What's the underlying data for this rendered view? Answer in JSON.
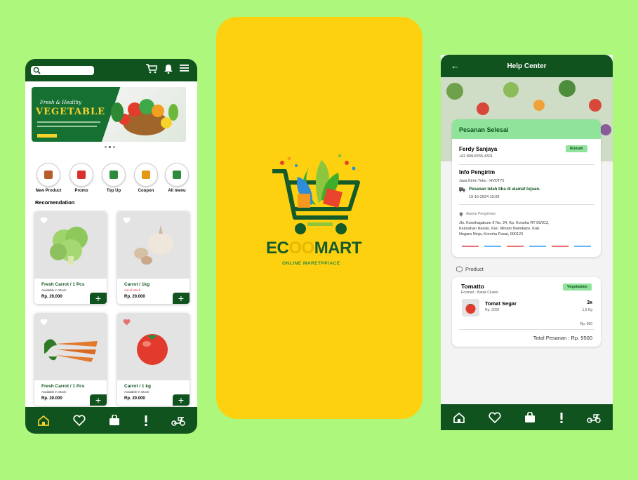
{
  "left_phone": {
    "banner": {
      "tagline": "Fresh & Healthy",
      "headline": "VEGETABLE"
    },
    "categories": [
      {
        "label": "New Product",
        "icon": "box-icon",
        "color": "#b85c2a"
      },
      {
        "label": "Promo",
        "icon": "promo-tag-icon",
        "color": "#d9302c"
      },
      {
        "label": "Top Up",
        "icon": "phone-topup-icon",
        "color": "#2e8a3c"
      },
      {
        "label": "Coupon",
        "icon": "coupon-icon",
        "color": "#e39a12"
      },
      {
        "label": "All menu",
        "icon": "grid-menu-icon",
        "color": "#2e8a3c"
      }
    ],
    "section_title": "Recomendation",
    "products": [
      {
        "name": "Fresh Carrot / 1 Pcs",
        "stock": "Available in Stock",
        "stock_state": "in",
        "price": "Rp. 20.000",
        "image": "broccoli",
        "favorite": false
      },
      {
        "name": "Carrot / 1kg",
        "stock": "out of stock",
        "stock_state": "out",
        "price": "Rp. 20.000",
        "image": "garlic",
        "favorite": false
      },
      {
        "name": "Fresh Carrot / 1 Pcs",
        "stock": "Available in Stock",
        "stock_state": "in",
        "price": "Rp. 20.000",
        "image": "carrots",
        "favorite": false
      },
      {
        "name": "Carrot / 1 kg",
        "stock": "Available in Stock",
        "stock_state": "in",
        "price": "Rp. 20.000",
        "image": "tomato",
        "favorite": true
      }
    ],
    "add_label": "+"
  },
  "splash": {
    "brand_left": "EC",
    "brand_mid": "OO",
    "brand_right": "MART",
    "subtitle": "ONLINE MARETPPIACE",
    "background": "#fdd110"
  },
  "right_phone": {
    "header_title": "Help Center",
    "order_status": "Pesanan Selesai",
    "customer_name": "Ferdy Sanjaya",
    "customer_phone": "+62 809-8765-4321",
    "address_tag": "Rumah",
    "sender_title": "Info Pengirim",
    "shipping_service": "Jasa Kirim Toko : HVDT75",
    "delivery_status": "Pesanan telah tiba di alamat tujuan.",
    "delivery_time": "19-10-2024  15:09",
    "address_label": "Alamat Pengiriman",
    "address_lines": [
      "Jln. Konohagakure II No. 24, Kp. Konoha RT 05/012,",
      "Kelurahan Naruto, Kec. Minato Namikaze, Kab.",
      "Negara Ninja, Konoha Pusat, 000123"
    ],
    "product_section": "Product",
    "store_name": "Tomatto",
    "store_sub": "Ecomart - Batak Cluster",
    "store_badge": "Vegetables",
    "item_name": "Tomat Segar",
    "item_price": "Rp. 3000",
    "item_qty": "3x",
    "item_weight": "1,5 Kg",
    "item_subtotal": "Rp. 500",
    "total_label": "Total Pesanan : Rp. 9500"
  },
  "colors": {
    "primary": "#10531f",
    "accent": "#8fe39a",
    "background": "#adf77c"
  }
}
